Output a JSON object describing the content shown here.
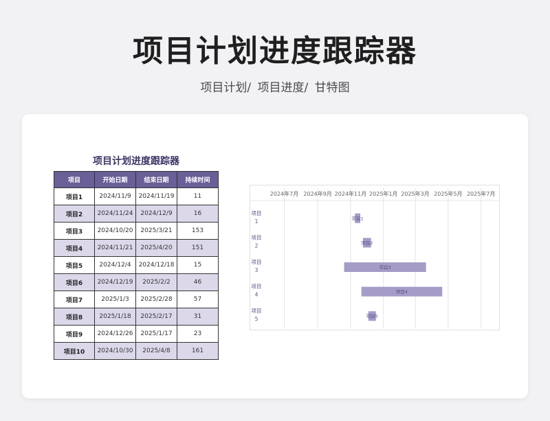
{
  "page": {
    "title": "项目计划进度跟踪器",
    "subtitle": [
      "项目计划/",
      "项目进度/",
      "甘特图"
    ]
  },
  "table": {
    "title": "项目计划进度跟踪器",
    "headers": [
      "项目",
      "开始日期",
      "结束日期",
      "持续时间"
    ],
    "rows": [
      [
        "项目1",
        "2024/11/9",
        "2024/11/19",
        "11"
      ],
      [
        "项目2",
        "2024/11/24",
        "2024/12/9",
        "16"
      ],
      [
        "项目3",
        "2024/10/20",
        "2025/3/21",
        "153"
      ],
      [
        "项目4",
        "2024/11/21",
        "2025/4/20",
        "151"
      ],
      [
        "项目5",
        "2024/12/4",
        "2024/12/18",
        "15"
      ],
      [
        "项目6",
        "2024/12/19",
        "2025/2/2",
        "46"
      ],
      [
        "项目7",
        "2025/1/3",
        "2025/2/28",
        "57"
      ],
      [
        "项目8",
        "2025/1/18",
        "2025/2/17",
        "31"
      ],
      [
        "项目9",
        "2024/12/26",
        "2025/1/17",
        "23"
      ],
      [
        "项目10",
        "2024/10/30",
        "2025/4/8",
        "161"
      ]
    ]
  },
  "chart_data": {
    "type": "bar",
    "orientation": "horizontal-gantt",
    "x_ticks": [
      "2024年7月",
      "2024年9月",
      "2024年11月",
      "2025年1月",
      "2025年3月",
      "2025年5月",
      "2025年7月"
    ],
    "x_tick_dates": [
      "2024-07-01",
      "2024-09-01",
      "2024-11-01",
      "2025-01-01",
      "2025-03-01",
      "2025-05-01",
      "2025-07-01"
    ],
    "xlim": [
      "2024-06-01",
      "2025-08-01"
    ],
    "categories": [
      "项目1",
      "项目2",
      "项目3",
      "项目4",
      "项目5"
    ],
    "category_lines": [
      [
        "项目",
        "1"
      ],
      [
        "项目",
        "2"
      ],
      [
        "项目",
        "3"
      ],
      [
        "项目",
        "4"
      ],
      [
        "项目",
        "5"
      ]
    ],
    "start": [
      "2024-11-09",
      "2024-11-24",
      "2024-10-20",
      "2024-11-21",
      "2024-12-04"
    ],
    "end": [
      "2024-11-19",
      "2024-12-09",
      "2025-03-21",
      "2025-04-20",
      "2024-12-18"
    ],
    "bar_labels": [
      "项目1",
      "项目2",
      "项目3",
      "项目4",
      "项目5"
    ],
    "grid": true,
    "bar_color": "#a59cc8",
    "label_color": "#5a4f86"
  }
}
